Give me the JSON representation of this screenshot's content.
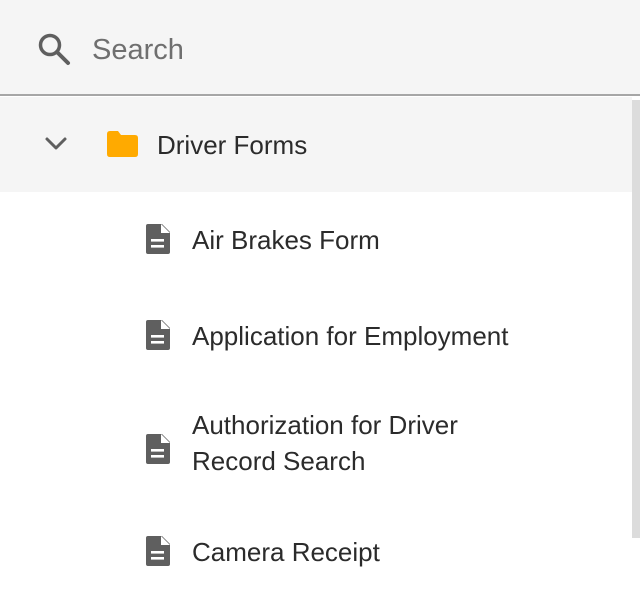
{
  "search": {
    "placeholder": "Search",
    "icon": "search-icon"
  },
  "tree": {
    "folder": {
      "label": "Driver Forms",
      "expanded": true,
      "icon": "folder-icon",
      "icon_color": "#FFAA00"
    },
    "files": [
      {
        "label": "Air Brakes Form",
        "icon": "document-icon"
      },
      {
        "label": "Application for Employment",
        "icon": "document-icon"
      },
      {
        "label": "Authorization for Driver Record Search",
        "icon": "document-icon"
      },
      {
        "label": "Camera Receipt",
        "icon": "document-icon"
      }
    ]
  },
  "colors": {
    "header_bg": "#F5F5F5",
    "divider": "#A6A6A6",
    "text": "#2B2B2B",
    "icon": "#5F5F5F",
    "folder": "#FFAA00"
  }
}
